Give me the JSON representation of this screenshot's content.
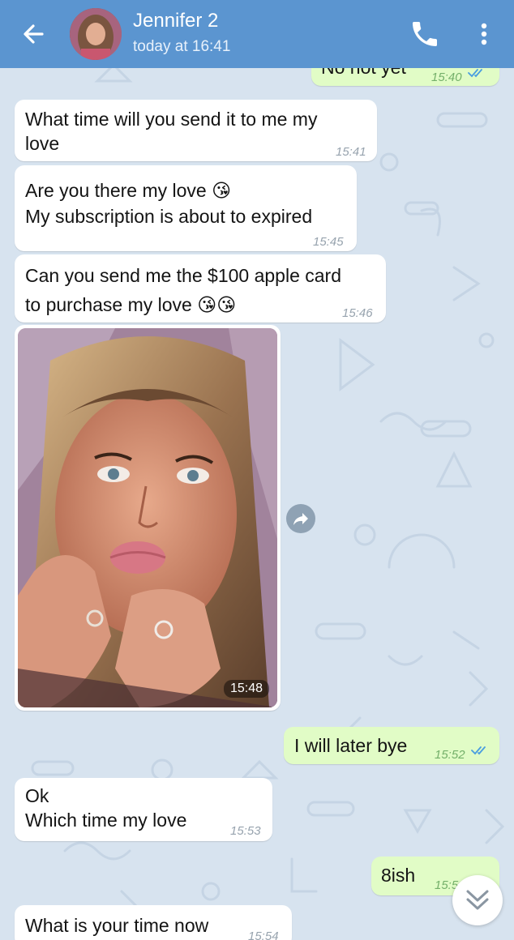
{
  "header": {
    "contact_name": "Jennifer 2",
    "status": "today at 16:41",
    "color": "#5b95d0"
  },
  "colors": {
    "incoming_bubble": "#ffffff",
    "outgoing_bubble": "#e1fcc6",
    "chat_background": "#d7e3ef",
    "read_ticks": "#4a9ee0"
  },
  "messages": [
    {
      "direction": "out",
      "text": "No not yet",
      "time": "15:40",
      "read": true
    },
    {
      "direction": "in",
      "text": "What time will you send it to me my\nlove",
      "time": "15:41"
    },
    {
      "direction": "in",
      "text": "Are you there my love 😘\nMy subscription is about to expired",
      "time": "15:45"
    },
    {
      "direction": "in",
      "text": "Can you send me the $100 apple card\nto purchase my love 😘😘",
      "time": "15:46"
    },
    {
      "direction": "in",
      "type": "photo",
      "time": "15:48"
    },
    {
      "direction": "out",
      "text": "I will later bye",
      "time": "15:52",
      "read": true
    },
    {
      "direction": "in",
      "text": "Ok\nWhich time my love",
      "time": "15:53"
    },
    {
      "direction": "out",
      "text": "8ish",
      "time": "15:5"
    },
    {
      "direction": "in",
      "text": "What is your time now",
      "time": "15:54"
    }
  ],
  "icons": {
    "back": "arrow-left-icon",
    "call": "phone-icon",
    "menu": "more-vertical-icon",
    "forward": "share-arrow-icon",
    "scroll_down": "chevron-double-down-icon"
  }
}
